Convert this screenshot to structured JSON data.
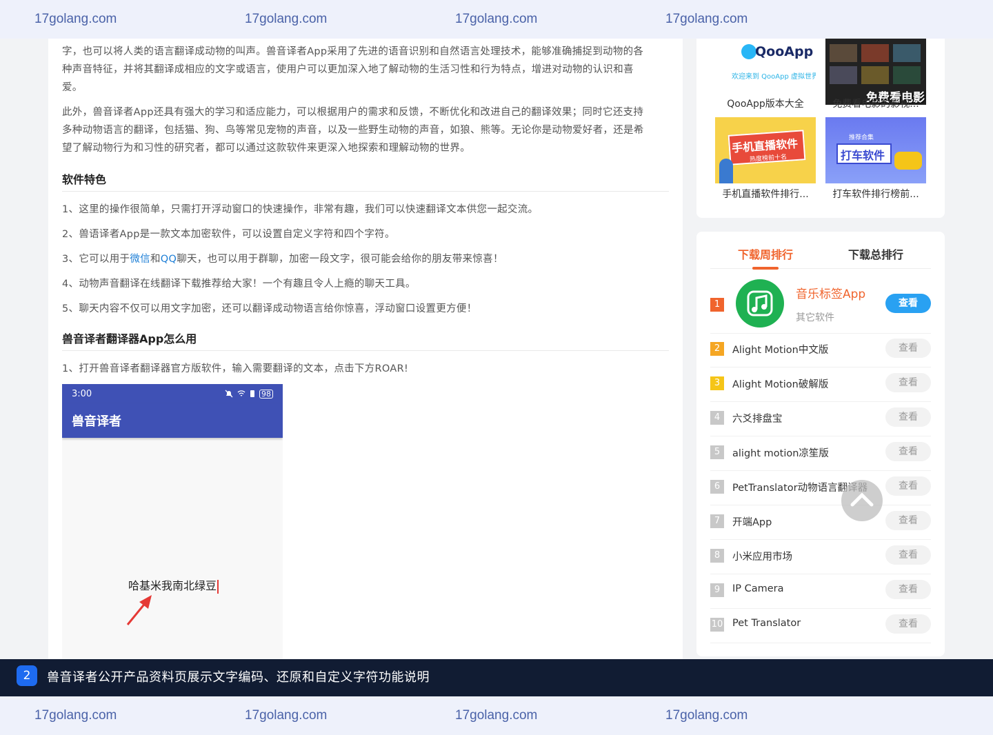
{
  "watermark": {
    "text": "17golang.com"
  },
  "article": {
    "para1_lines": [
      "字，也可以将人类的语言翻译成动物的叫声。兽音译者App采用了先进的语音识别和自然语言处理技术，能够准确捕捉到动物的各",
      "种声音特征，并将其翻译成相应的文字或语言，使用户可以更加深入地了解动物的生活习性和行为特点，增进对动物的认识和喜",
      "爱。"
    ],
    "para2_lines": [
      "此外，兽音译者App还具有强大的学习和适应能力，可以根据用户的需求和反馈，不断优化和改进自己的翻译效果；同时它还支持",
      "多种动物语言的翻译，包括猫、狗、鸟等常见宠物的声音，以及一些野生动物的声音，如狼、熊等。无论你是动物爱好者，还是希",
      "望了解动物行为和习性的研究者，都可以通过这款软件来更深入地探索和理解动物的世界。"
    ],
    "features_heading": "软件特色",
    "feature1": "1、这里的操作很简单，只需打开浮动窗口的快速操作，非常有趣，我们可以快速翻译文本供您一起交流。",
    "feature2": "2、兽语译者App是一款文本加密软件，可以设置自定义字符和四个字符。",
    "feature3_a": "3、它可以用于",
    "feature3_link1": "微信",
    "feature3_b": "和",
    "feature3_link2": "QQ",
    "feature3_c": "聊天，也可以用于群聊，加密一段文字，很可能会给你的朋友带来惊喜！",
    "feature4": "4、动物声音翻译在线翻译下载推荐给大家！一个有趣且令人上瘾的聊天工具。",
    "feature5": "5、聊天内容不仅可以用文字加密，还可以翻译成动物语言给你惊喜，浮动窗口设置更方便！",
    "howto_heading": "兽音译者翻译器App怎么用",
    "step1": "1、打开兽音译者翻译器官方版软件，输入需要翻译的文本，点击下方ROAR!"
  },
  "phone": {
    "time": "3:00",
    "battery": "98",
    "app_title": "兽音译者",
    "input_text": "哈基米我南北绿豆"
  },
  "thumbs": [
    {
      "caption": "QooApp版本大全",
      "logo": "QooApp",
      "tagline": "欢迎来到 QooApp 虚拟世界"
    },
    {
      "caption": "免费看电影的影视...",
      "overlay": "免费看电影"
    },
    {
      "caption": "手机直播软件排行...",
      "banner": "手机直播软件",
      "sub": "热度榜前十名"
    },
    {
      "caption": "打车软件排行榜前...",
      "banner": "打车软件",
      "sub": "推荐合集"
    }
  ],
  "ranking": {
    "tab_week": "下载周排行",
    "tab_total": "下载总排行",
    "top": {
      "rank": "1",
      "name": "音乐标签App",
      "category": "其它软件",
      "button": "查看"
    },
    "items": [
      {
        "rank": "2",
        "name": "Alight Motion中文版",
        "button": "查看"
      },
      {
        "rank": "3",
        "name": "Alight Motion破解版",
        "button": "查看"
      },
      {
        "rank": "4",
        "name": "六爻排盘宝",
        "button": "查看"
      },
      {
        "rank": "5",
        "name": "alight motion凉笙版",
        "button": "查看"
      },
      {
        "rank": "6",
        "name": "PetTranslator动物语言翻译器",
        "button": "查看"
      },
      {
        "rank": "7",
        "name": "开端App",
        "button": "查看"
      },
      {
        "rank": "8",
        "name": "小米应用市场",
        "button": "查看"
      },
      {
        "rank": "9",
        "name": "IP Camera",
        "button": "查看"
      },
      {
        "rank": "10",
        "name": "Pet Translator",
        "button": "查看"
      }
    ],
    "colors": {
      "rank1": "#f0642d",
      "rank2": "#f5a623",
      "rank3": "#f5c518",
      "rank_other": "#c8c8c8",
      "accent": "#f0642d",
      "button_primary": "#29a1f2"
    }
  },
  "caption": {
    "badge": "2",
    "text": "兽音译者公开产品资料页展示文字编码、还原和自定义字符功能说明"
  }
}
